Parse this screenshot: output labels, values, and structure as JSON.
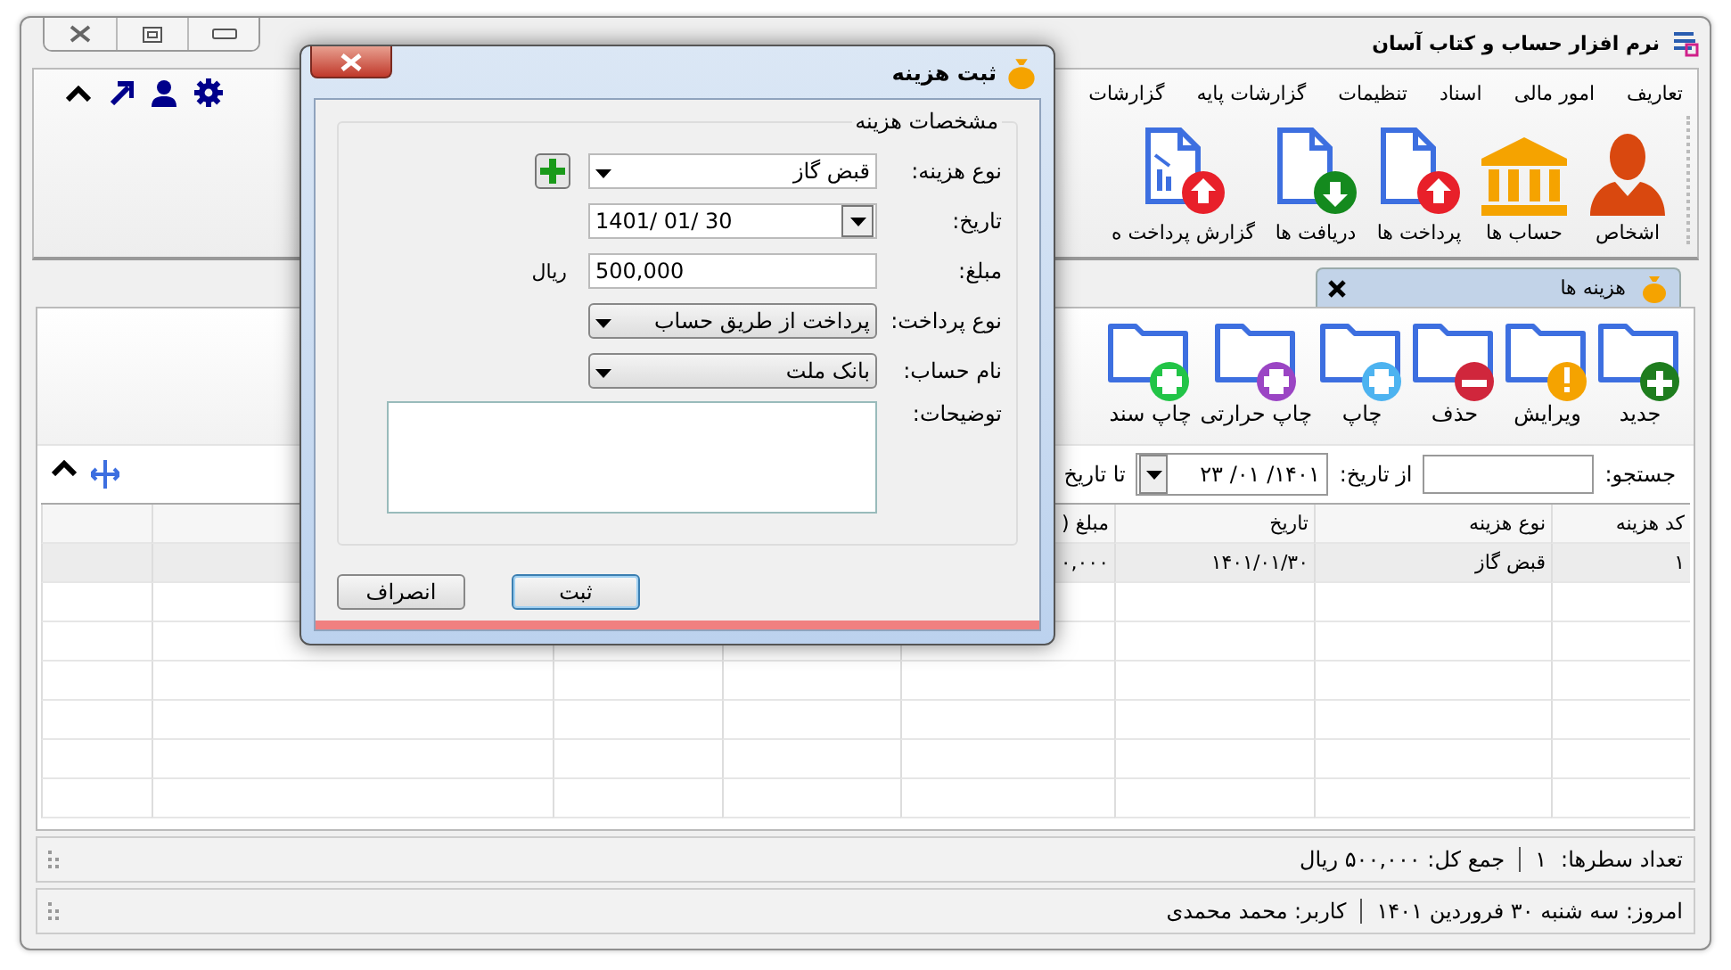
{
  "window": {
    "title": "نرم افزار حساب و کتاب آسان"
  },
  "menu": [
    "تعاریف",
    "امور مالی",
    "اسناد",
    "تنظیمات",
    "گزارشات پایه",
    "گزارشات"
  ],
  "ribbon": [
    {
      "label": "اشخاص",
      "kind": "person"
    },
    {
      "label": "حساب ها",
      "kind": "bank"
    },
    {
      "label": "پرداخت ها",
      "kind": "payment"
    },
    {
      "label": "دریافت ها",
      "kind": "receipt"
    },
    {
      "label": "گزارش پرداخت ه",
      "kind": "report"
    }
  ],
  "tabs": [
    {
      "label": "هزینه ها",
      "selected": true
    }
  ],
  "toolbar": [
    {
      "label": "جدید",
      "kind": "add",
      "color": "#1e7d1e"
    },
    {
      "label": "ویرایش",
      "kind": "edit",
      "color": "#f5a300"
    },
    {
      "label": "حذف",
      "kind": "delete",
      "color": "#d0263c"
    },
    {
      "label": "چاپ",
      "kind": "print",
      "color": "#4db3f0"
    },
    {
      "label": "چاپ حرارتی",
      "kind": "print",
      "color": "#9b45c4"
    },
    {
      "label": "چاپ سند",
      "kind": "print",
      "color": "#22c447"
    }
  ],
  "filters": {
    "search_label": "جستجو:",
    "from_label": "از تاریخ:",
    "from_value": "۱۴۰۱/ ۰۱/ ۲۳",
    "to_label": "تا تاریخ"
  },
  "table": {
    "columns": [
      "کد هزینه",
      "نوع هزینه",
      "تاریخ",
      "مبلغ ("
    ],
    "rows": [
      {
        "cells": [
          "۱",
          "قبض گاز",
          "۱۴۰۱/۰۱/۳۰",
          "۰,۰۰۰"
        ],
        "selected": true
      }
    ]
  },
  "status_bar": {
    "row_count_label": "تعداد سطرها:",
    "row_count": "۱",
    "total": "جمع کل: ۵۰۰,۰۰۰ ریال"
  },
  "footer": {
    "today": "امروز: سه شنبه ۳۰ فروردین ۱۴۰۱",
    "user": "کاربر: محمد محمدی"
  },
  "dialog": {
    "title": "ثبت هزینه",
    "group": "مشخصات هزینه",
    "fields": [
      {
        "label": "نوع هزینه:",
        "kind": "combo",
        "value": "قبض گاز",
        "add_button": true
      },
      {
        "label": "تاریخ:",
        "kind": "date",
        "value": "1401/ 01/ 30"
      },
      {
        "label": "مبلغ:",
        "kind": "text",
        "value": "500,000",
        "unit": "ریال"
      },
      {
        "label": "نوع پرداخت:",
        "kind": "dropdown",
        "value": "پرداخت از طریق حساب"
      },
      {
        "label": "نام حساب:",
        "kind": "dropdown",
        "value": "بانک ملت"
      },
      {
        "label": "توضیحات:",
        "kind": "memo"
      }
    ],
    "buttons": [
      {
        "label": "ثبت",
        "focused": true
      },
      {
        "label": "انصراف",
        "focused": false
      }
    ]
  }
}
